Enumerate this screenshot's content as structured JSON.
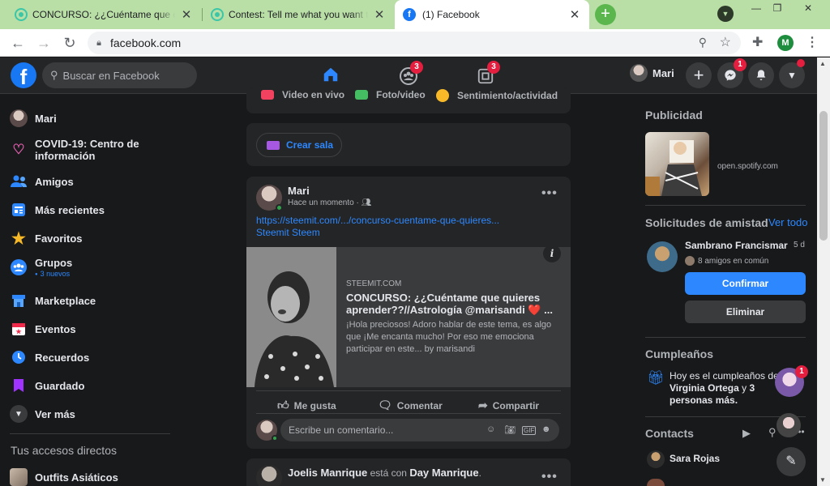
{
  "browser": {
    "tabs": [
      {
        "title": "CONCURSO: ¿¿Cuéntame que quieres aprender??//Astrología",
        "active": false,
        "favicon_color": "#3cc6a8"
      },
      {
        "title": "Contest: Tell me what you want to learn",
        "active": false,
        "favicon_color": "#3cc6a8"
      },
      {
        "title": "(1) Facebook",
        "active": true,
        "favicon_color": "#1877f2"
      }
    ],
    "new_tab": "+",
    "url": "facebook.com",
    "profile_initial": "M",
    "window_buttons": [
      "—",
      "❐",
      "✕"
    ]
  },
  "fb": {
    "logo": "f",
    "search_placeholder": "Buscar en Facebook",
    "nav": [
      {
        "icon": "home-icon",
        "active": true,
        "badge": ""
      },
      {
        "icon": "groups-icon",
        "active": false,
        "badge": "3"
      },
      {
        "icon": "gaming-icon",
        "active": false,
        "badge": "3"
      }
    ],
    "me_name": "Mari",
    "messenger_badge": "1",
    "colors": {
      "accent": "#2d88ff",
      "badge": "#e41e3f",
      "background": "#18191a",
      "card": "#242526"
    }
  },
  "sidebar": {
    "items": [
      {
        "label": "Mari",
        "sub": ""
      },
      {
        "label": "COVID-19: Centro de información",
        "sub": ""
      },
      {
        "label": "Amigos",
        "sub": ""
      },
      {
        "label": "Más recientes",
        "sub": ""
      },
      {
        "label": "Favoritos",
        "sub": ""
      },
      {
        "label": "Grupos",
        "sub": "3 nuevos"
      },
      {
        "label": "Marketplace",
        "sub": ""
      },
      {
        "label": "Eventos",
        "sub": ""
      },
      {
        "label": "Recuerdos",
        "sub": ""
      },
      {
        "label": "Guardado",
        "sub": ""
      },
      {
        "label": "Ver más",
        "sub": ""
      }
    ],
    "shortcuts_title": "Tus accesos directos",
    "shortcuts": [
      {
        "label": "Outfits Asiáticos"
      }
    ]
  },
  "composer": {
    "options": [
      "Video en vivo",
      "Foto/video",
      "Sentimiento/actividad"
    ],
    "room_button": "Crear sala"
  },
  "post": {
    "author": "Mari",
    "time": "Hace un momento",
    "link_text": "https://steemit.com/.../concurso-cuentame-que-quieres...",
    "link_text2": "Steemit Steem",
    "preview": {
      "domain": "STEEMIT.COM",
      "title": "CONCURSO: ¿¿Cuéntame que quieres aprender??//Astrología @marisandi ❤️ ...",
      "description": "¡Hola preciosos! Adoro hablar de este tema, es algo que ¡Me encanta mucho! Por eso me emociona participar en este... by marisandi"
    },
    "actions": [
      "Me gusta",
      "Comentar",
      "Compartir"
    ],
    "comment_placeholder": "Escribe un comentario..."
  },
  "next_post": {
    "author": "Joelis Manrique",
    "with": "está con",
    "tagged": "Day Manrique",
    "punct": "."
  },
  "right": {
    "ads_title": "Publicidad",
    "ad_domain": "open.spotify.com",
    "requests_title": "Solicitudes de amistad",
    "see_all": "Ver todo",
    "request": {
      "name": "Sambrano Francismar",
      "age": "5 d",
      "mutual": "8 amigos en común",
      "confirm": "Confirmar",
      "delete": "Eliminar"
    },
    "birthdays_title": "Cumpleaños",
    "birthday_line1": "Hoy es el cumpleaños de",
    "birthday_name": "Virginia Ortega",
    "birthday_line2": " y",
    "birthday_line3": "3 personas más.",
    "contacts_title": "Contacts",
    "contacts": [
      {
        "name": "Sara Rojas"
      }
    ],
    "chat_badge": "1"
  }
}
